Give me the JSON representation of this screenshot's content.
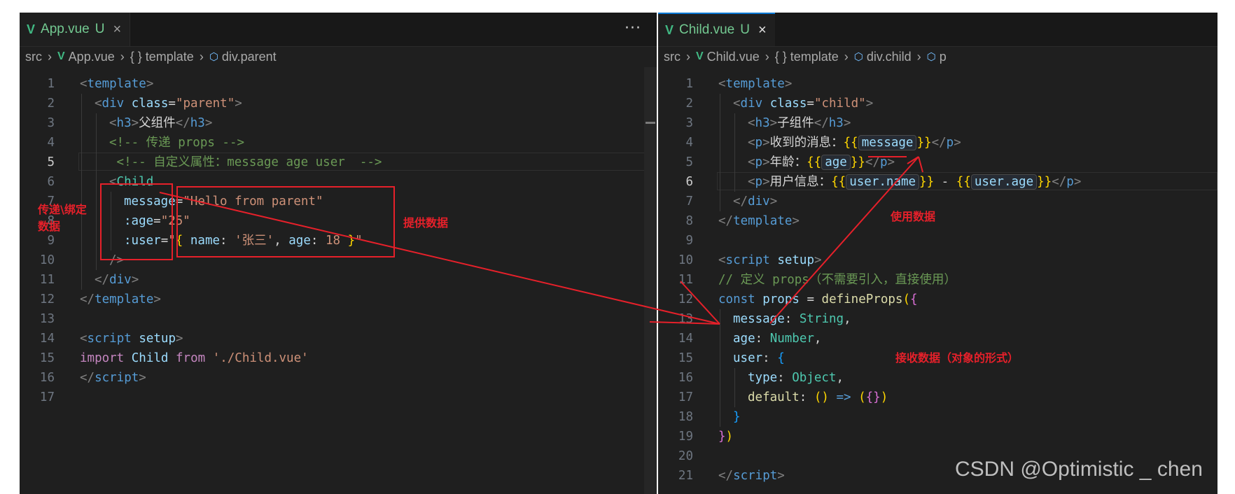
{
  "left_editor": {
    "tab": {
      "icon": "vue-icon",
      "filename": "App.vue",
      "status": "U",
      "close": "×"
    },
    "more_actions": "···",
    "breadcrumb": [
      "src",
      "App.vue",
      "{ } template",
      "div.parent"
    ],
    "lines": [
      {
        "n": "1",
        "i": 0,
        "t": [
          [
            "<",
            "tg"
          ],
          [
            "template",
            "tn"
          ],
          [
            ">",
            "tg"
          ]
        ]
      },
      {
        "n": "2",
        "i": 1,
        "t": [
          [
            "<",
            "tg"
          ],
          [
            "div",
            "tn"
          ],
          [
            " "
          ],
          [
            "class",
            "at"
          ],
          [
            "="
          ],
          [
            "\"parent\"",
            "st"
          ],
          [
            ">",
            "tg"
          ]
        ]
      },
      {
        "n": "3",
        "i": 2,
        "t": [
          [
            "<",
            "tg"
          ],
          [
            "h3",
            "tn"
          ],
          [
            ">",
            "tg"
          ],
          [
            "父组件"
          ],
          [
            "</",
            "tg"
          ],
          [
            "h3",
            "tn"
          ],
          [
            ">",
            "tg"
          ]
        ]
      },
      {
        "n": "4",
        "i": 2,
        "t": [
          [
            "<!-- 传递 props -->",
            "cm"
          ]
        ]
      },
      {
        "n": "5",
        "i": 2,
        "t": [
          [
            " <!-- 自定义属性：message age user  -->",
            "cm"
          ]
        ],
        "active": true
      },
      {
        "n": "6",
        "i": 2,
        "t": [
          [
            "<",
            "tg"
          ],
          [
            "Child",
            "ty"
          ]
        ]
      },
      {
        "n": "7",
        "i": 3,
        "t": [
          [
            "message",
            "at"
          ],
          [
            "="
          ],
          [
            "\"Hello from parent\"",
            "st"
          ]
        ]
      },
      {
        "n": "8",
        "i": 3,
        "t": [
          [
            ":age",
            "at"
          ],
          [
            "="
          ],
          [
            "\"25\"",
            "st"
          ]
        ]
      },
      {
        "n": "9",
        "i": 3,
        "t": [
          [
            ":user",
            "at"
          ],
          [
            "="
          ],
          [
            "\"",
            "st"
          ],
          [
            "{",
            "br1"
          ],
          [
            " "
          ],
          [
            "name",
            "vn"
          ],
          [
            ": "
          ],
          [
            "'张三'",
            "st"
          ],
          [
            ", "
          ],
          [
            "age",
            "vn"
          ],
          [
            ": "
          ],
          [
            "18",
            "st"
          ],
          [
            " "
          ],
          [
            "}",
            "br1"
          ],
          [
            "\"",
            "st"
          ]
        ]
      },
      {
        "n": "10",
        "i": 2,
        "t": [
          [
            "/>",
            "tg"
          ]
        ]
      },
      {
        "n": "11",
        "i": 1,
        "t": [
          [
            "</",
            "tg"
          ],
          [
            "div",
            "tn"
          ],
          [
            ">",
            "tg"
          ]
        ]
      },
      {
        "n": "12",
        "i": 0,
        "t": [
          [
            "</",
            "tg"
          ],
          [
            "template",
            "tn"
          ],
          [
            ">",
            "tg"
          ]
        ]
      },
      {
        "n": "13",
        "i": 0,
        "t": []
      },
      {
        "n": "14",
        "i": 0,
        "t": [
          [
            "<",
            "tg"
          ],
          [
            "script",
            "tn"
          ],
          [
            " "
          ],
          [
            "setup",
            "at"
          ],
          [
            ">",
            "tg"
          ]
        ]
      },
      {
        "n": "15",
        "i": 0,
        "t": [
          [
            "import",
            "kc"
          ],
          [
            " "
          ],
          [
            "Child",
            "vn"
          ],
          [
            " "
          ],
          [
            "from",
            "kc"
          ],
          [
            " "
          ],
          [
            "'./Child.vue'",
            "st"
          ]
        ]
      },
      {
        "n": "16",
        "i": 0,
        "t": [
          [
            "</",
            "tg"
          ],
          [
            "script",
            "tn"
          ],
          [
            ">",
            "tg"
          ]
        ]
      },
      {
        "n": "17",
        "i": 0,
        "t": []
      }
    ]
  },
  "right_editor": {
    "tab": {
      "icon": "vue-icon",
      "filename": "Child.vue",
      "status": "U",
      "close": "×"
    },
    "breadcrumb": [
      "src",
      "Child.vue",
      "{ } template",
      "div.child",
      "p"
    ],
    "lines": [
      {
        "n": "1",
        "i": 0,
        "t": [
          [
            "<",
            "tg"
          ],
          [
            "template",
            "tn"
          ],
          [
            ">",
            "tg"
          ]
        ]
      },
      {
        "n": "2",
        "i": 1,
        "t": [
          [
            "<",
            "tg"
          ],
          [
            "div",
            "tn"
          ],
          [
            " "
          ],
          [
            "class",
            "at"
          ],
          [
            "="
          ],
          [
            "\"child\"",
            "st"
          ],
          [
            ">",
            "tg"
          ]
        ]
      },
      {
        "n": "3",
        "i": 2,
        "t": [
          [
            "<",
            "tg"
          ],
          [
            "h3",
            "tn"
          ],
          [
            ">",
            "tg"
          ],
          [
            "子组件"
          ],
          [
            "</",
            "tg"
          ],
          [
            "h3",
            "tn"
          ],
          [
            ">",
            "tg"
          ]
        ]
      },
      {
        "n": "4",
        "i": 2,
        "t": [
          [
            "<",
            "tg"
          ],
          [
            "p",
            "tn"
          ],
          [
            ">",
            "tg"
          ],
          [
            "收到的消息："
          ],
          [
            "{{",
            "br1"
          ],
          [
            "message",
            "hl"
          ],
          [
            "}}",
            "br1"
          ],
          [
            "</",
            "tg"
          ],
          [
            "p",
            "tn"
          ],
          [
            ">",
            "tg"
          ]
        ]
      },
      {
        "n": "5",
        "i": 2,
        "t": [
          [
            "<",
            "tg"
          ],
          [
            "p",
            "tn"
          ],
          [
            ">",
            "tg"
          ],
          [
            "年龄："
          ],
          [
            "{{",
            "br1"
          ],
          [
            "age",
            "hl"
          ],
          [
            "}}",
            "br1"
          ],
          [
            "</",
            "tg"
          ],
          [
            "p",
            "tn"
          ],
          [
            ">",
            "tg"
          ]
        ]
      },
      {
        "n": "6",
        "i": 2,
        "t": [
          [
            "<",
            "tg"
          ],
          [
            "p",
            "tn"
          ],
          [
            ">",
            "tg"
          ],
          [
            "用户信息："
          ],
          [
            "{{",
            "br1"
          ],
          [
            "user.name",
            "hl"
          ],
          [
            "}}",
            "br1"
          ],
          [
            " - "
          ],
          [
            "{{",
            "br1"
          ],
          [
            "user.age",
            "hl"
          ],
          [
            "}}",
            "br1"
          ],
          [
            "</",
            "tg"
          ],
          [
            "p",
            "tn"
          ],
          [
            ">",
            "tg"
          ]
        ],
        "active": true
      },
      {
        "n": "7",
        "i": 1,
        "t": [
          [
            "</",
            "tg"
          ],
          [
            "div",
            "tn"
          ],
          [
            ">",
            "tg"
          ]
        ]
      },
      {
        "n": "8",
        "i": 0,
        "t": [
          [
            "</",
            "tg"
          ],
          [
            "template",
            "tn"
          ],
          [
            ">",
            "tg"
          ]
        ]
      },
      {
        "n": "9",
        "i": 0,
        "t": []
      },
      {
        "n": "10",
        "i": 0,
        "t": [
          [
            "<",
            "tg"
          ],
          [
            "script",
            "tn"
          ],
          [
            " "
          ],
          [
            "setup",
            "at"
          ],
          [
            ">",
            "tg"
          ]
        ]
      },
      {
        "n": "11",
        "i": 0,
        "t": [
          [
            "// 定义 props（不需要引入，直接使用）",
            "cm"
          ]
        ]
      },
      {
        "n": "12",
        "i": 0,
        "t": [
          [
            "const",
            "kw"
          ],
          [
            " "
          ],
          [
            "props",
            "vn"
          ],
          [
            " = "
          ],
          [
            "defineProps",
            "fn"
          ],
          [
            "(",
            "br1"
          ],
          [
            "{",
            "br2"
          ]
        ]
      },
      {
        "n": "13",
        "i": 1,
        "t": [
          [
            "message",
            "vn"
          ],
          [
            ": "
          ],
          [
            "String",
            "ty"
          ],
          [
            ","
          ]
        ]
      },
      {
        "n": "14",
        "i": 1,
        "t": [
          [
            "age",
            "vn"
          ],
          [
            ": "
          ],
          [
            "Number",
            "ty"
          ],
          [
            ","
          ]
        ]
      },
      {
        "n": "15",
        "i": 1,
        "t": [
          [
            "user",
            "vn"
          ],
          [
            ": "
          ],
          [
            "{",
            "br3"
          ]
        ]
      },
      {
        "n": "16",
        "i": 2,
        "t": [
          [
            "type",
            "vn"
          ],
          [
            ": "
          ],
          [
            "Object",
            "ty"
          ],
          [
            ","
          ]
        ]
      },
      {
        "n": "17",
        "i": 2,
        "t": [
          [
            "default",
            "fn"
          ],
          [
            ": "
          ],
          [
            "()",
            "br1"
          ],
          [
            " "
          ],
          [
            "=>",
            "kw"
          ],
          [
            " "
          ],
          [
            "(",
            "br1"
          ],
          [
            "{}",
            "br2"
          ],
          [
            ")",
            "br1"
          ]
        ]
      },
      {
        "n": "18",
        "i": 1,
        "t": [
          [
            "}",
            "br3"
          ]
        ]
      },
      {
        "n": "19",
        "i": 0,
        "t": [
          [
            "}",
            "br2"
          ],
          [
            ")",
            "br1"
          ]
        ]
      },
      {
        "n": "20",
        "i": 0,
        "t": []
      },
      {
        "n": "21",
        "i": 0,
        "t": [
          [
            "</",
            "tg"
          ],
          [
            "script",
            "tn"
          ],
          [
            ">",
            "tg"
          ]
        ]
      }
    ]
  },
  "annotations": {
    "bind_label": "传递\\绑定\n数据",
    "provide_label": "提供数据",
    "use_label": "使用数据",
    "receive_label": "接收数据（对象的形式）",
    "color": "#e6202a"
  },
  "watermark": "CSDN @Optimistic _ chen",
  "colors": {
    "editor_bg": "#1f1f1f",
    "tab_modified": "#73c991",
    "vue_green": "#41b883",
    "active_tab_border": "#0078d4"
  }
}
